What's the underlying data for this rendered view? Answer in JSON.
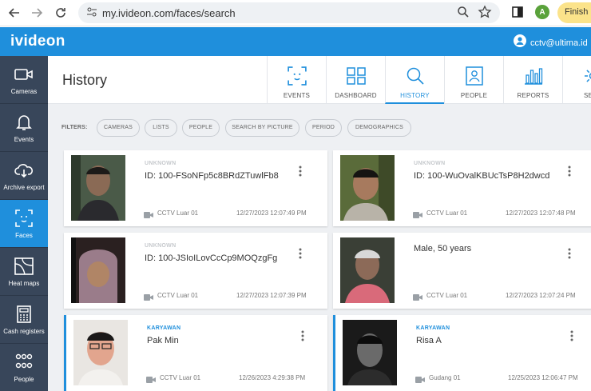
{
  "browser": {
    "url": "my.ivideon.com/faces/search",
    "profile_initial": "A",
    "finish_label": "Finish u"
  },
  "app": {
    "logo": "ivideon",
    "user_email": "cctv@ultima.id",
    "page_title": "History",
    "accent": "#1f8fdc"
  },
  "sidebar": {
    "items": [
      {
        "label": "Cameras",
        "icon": "camera-icon"
      },
      {
        "label": "Events",
        "icon": "bell-icon"
      },
      {
        "label": "Archive export",
        "icon": "cloud-download-icon"
      },
      {
        "label": "Faces",
        "icon": "face-scan-icon",
        "active": true
      },
      {
        "label": "Heat maps",
        "icon": "heatmap-icon"
      },
      {
        "label": "Cash registers",
        "icon": "cash-register-icon"
      },
      {
        "label": "People",
        "icon": "people-icon"
      }
    ]
  },
  "tabs": [
    {
      "label": "EVENTS",
      "icon": "face-scan-icon"
    },
    {
      "label": "DASHBOARD",
      "icon": "dashboard-icon"
    },
    {
      "label": "HISTORY",
      "icon": "search-icon",
      "active": true
    },
    {
      "label": "PEOPLE",
      "icon": "person-card-icon"
    },
    {
      "label": "REPORTS",
      "icon": "bar-chart-icon"
    },
    {
      "label": "SET",
      "icon": "gear-icon"
    }
  ],
  "filters": {
    "label": "FILTERS:",
    "chips": [
      "CAMERAS",
      "LISTS",
      "PEOPLE",
      "SEARCH BY PICTURE",
      "PERIOD",
      "DEMOGRAPHICS"
    ]
  },
  "cards": [
    {
      "tag": "UNKNOWN",
      "name": "ID: 100-FSoNFp5c8BRdZTuwlFb8",
      "camera": "CCTV Luar 01",
      "time": "12/27/2023 12:07:49 PM"
    },
    {
      "tag": "UNKNOWN",
      "name": "ID: 100-WuOvalKBUcTsP8H2dwcd",
      "camera": "CCTV Luar 01",
      "time": "12/27/2023 12:07:48 PM"
    },
    {
      "tag": "UNKNOWN",
      "name": "ID: 100-JSIoILovCcCp9MOQzgFg",
      "camera": "CCTV Luar 01",
      "time": "12/27/2023 12:07:39 PM"
    },
    {
      "tag": "",
      "name": "Male, 50 years",
      "camera": "CCTV Luar 01",
      "time": "12/27/2023 12:07:24 PM"
    },
    {
      "tag": "KARYAWAN",
      "name": "Pak Min",
      "camera": "CCTV Luar 01",
      "time": "12/26/2023 4:29:38 PM"
    },
    {
      "tag": "KARYAWAN",
      "name": "Risa A",
      "camera": "Gudang 01",
      "time": "12/25/2023 12:06:47 PM"
    }
  ]
}
